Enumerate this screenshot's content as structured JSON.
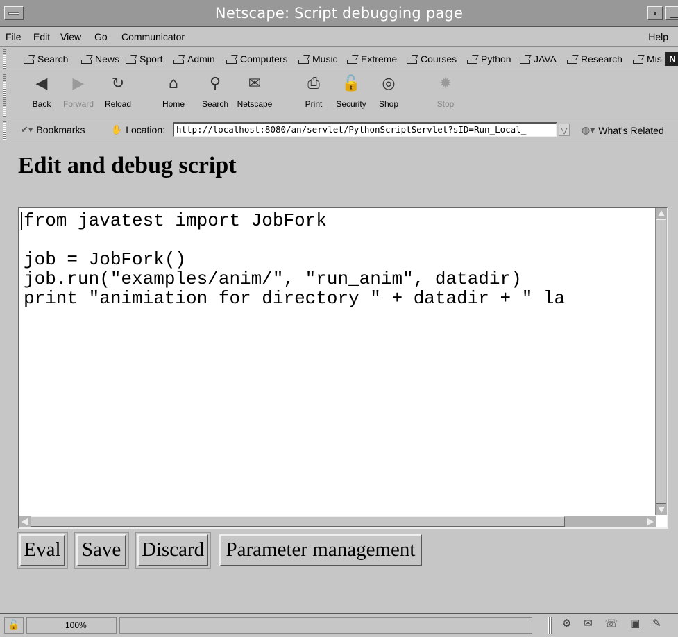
{
  "window": {
    "title": "Netscape: Script debugging page"
  },
  "menubar": {
    "items": [
      "File",
      "Edit",
      "View",
      "Go",
      "Communicator"
    ],
    "help": "Help"
  },
  "personal_toolbar": {
    "items": [
      "Search",
      "News",
      "Sport",
      "Admin",
      "Computers",
      "Music",
      "Extreme",
      "Courses",
      "Python",
      "JAVA",
      "Research",
      "Mis"
    ],
    "logo_text": "N"
  },
  "nav_toolbar": {
    "buttons": [
      {
        "label": "Back",
        "icon": "back-icon",
        "glyph": "◀"
      },
      {
        "label": "Forward",
        "icon": "forward-icon",
        "glyph": "▶"
      },
      {
        "label": "Reload",
        "icon": "reload-icon",
        "glyph": "↻"
      },
      {
        "label": "Home",
        "icon": "home-icon",
        "glyph": "⌂"
      },
      {
        "label": "Search",
        "icon": "search-icon",
        "glyph": "⚲"
      },
      {
        "label": "Netscape",
        "icon": "netscape-icon",
        "glyph": "✉"
      },
      {
        "label": "Print",
        "icon": "print-icon",
        "glyph": "⎙"
      },
      {
        "label": "Security",
        "icon": "security-icon",
        "glyph": "🔓"
      },
      {
        "label": "Shop",
        "icon": "shop-icon",
        "glyph": "◎"
      },
      {
        "label": "Stop",
        "icon": "stop-icon",
        "glyph": "✹"
      }
    ]
  },
  "location_bar": {
    "bookmarks_label": "Bookmarks",
    "location_label": "Location:",
    "url": "http://localhost:8080/an/servlet/PythonScriptServlet?sID=Run_Local_",
    "related_label": "What's Related"
  },
  "page": {
    "heading": "Edit and debug script",
    "script": "from javatest import JobFork\n\njob = JobFork()\njob.run(\"examples/anim/\", \"run_anim\", datadir)\nprint \"animiation for directory \" + datadir + \" la",
    "buttons": {
      "eval": "Eval",
      "save": "Save",
      "discard": "Discard",
      "params": "Parameter management"
    }
  },
  "statusbar": {
    "zoom": "100%",
    "message": ""
  }
}
